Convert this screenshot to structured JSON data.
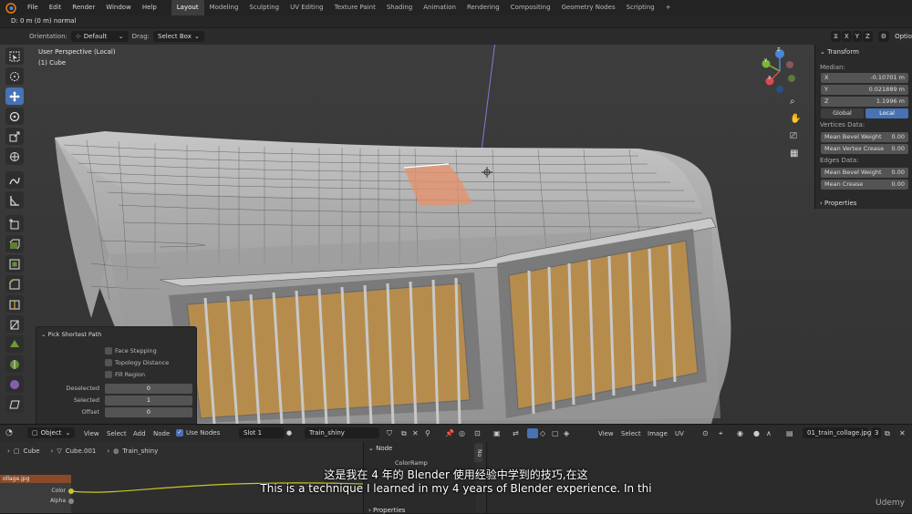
{
  "menu": [
    "File",
    "Edit",
    "Render",
    "Window",
    "Help"
  ],
  "workspaces": [
    "Layout",
    "Modeling",
    "Sculpting",
    "UV Editing",
    "Texture Paint",
    "Shading",
    "Animation",
    "Rendering",
    "Compositing",
    "Geometry Nodes",
    "Scripting"
  ],
  "workspace_add": "+",
  "status_text": "D: 0 m (0 m) normal",
  "header": {
    "orientation_label": "Orientation:",
    "orientation_value": "Default",
    "drag_label": "Drag:",
    "drag_value": "Select Box",
    "axes": [
      "X",
      "Y",
      "Z"
    ],
    "options": "Optio"
  },
  "viewport": {
    "perspective": "User Perspective (Local)",
    "object": "(1) Cube"
  },
  "gizmo": {
    "x": "X",
    "y": "Y",
    "z": "Z"
  },
  "npanel": {
    "transform": "Transform",
    "median": "Median:",
    "x_label": "X",
    "x_value": "-0.10701 m",
    "y_label": "Y",
    "y_value": "0.021889 m",
    "z_label": "Z",
    "z_value": "1.1996 m",
    "global": "Global",
    "local": "Local",
    "vertices_data": "Vertices Data:",
    "mean_bevel_weight": "Mean Bevel Weight",
    "mbw_value": "0.00",
    "mean_vertex_crease": "Mean Vertex Crease",
    "mvc_value": "0.00",
    "edges_data": "Edges Data:",
    "mean_bevel_weight2": "Mean Bevel Weight",
    "mbw2_value": "0.00",
    "mean_crease": "Mean Crease",
    "mc_value": "0.00",
    "properties": "Properties"
  },
  "operator": {
    "title": "Pick Shortest Path",
    "face_stepping": "Face Stepping",
    "topology_distance": "Topology Distance",
    "fill_region": "Fill Region",
    "deselected_label": "Deselected",
    "deselected_value": "0",
    "selected_label": "Selected",
    "selected_value": "1",
    "offset_label": "Offset",
    "offset_value": "0"
  },
  "node_header": {
    "object": "Object",
    "menus": [
      "View",
      "Select",
      "Add",
      "Node"
    ],
    "use_nodes": "Use Nodes",
    "slot": "Slot 1",
    "material": "Train_shiny"
  },
  "image_header": {
    "menus": [
      "View",
      "Select",
      "Image",
      "UV"
    ],
    "image_name": "01_train_collage.jpg",
    "users": "3"
  },
  "breadcrumb": [
    "Cube",
    "Cube.001",
    "Train_shiny"
  ],
  "node_panel": {
    "title": "Node",
    "colorramp": "ColorRamp",
    "properties": "Properties",
    "tab": "No"
  },
  "image_node": {
    "title": "ollage.jpg",
    "color": "Color",
    "alpha": "Alpha"
  },
  "subtitles": {
    "chinese": "这是我在 4 年的 Blender 使用经验中学到的技巧,在这",
    "english": "This is a technique I learned in my 4 years of Blender experience. In thi"
  },
  "watermark": "Udemy",
  "colors": {
    "accent": "#4772b3",
    "selection": "#e8906a",
    "gizmo_x": "#d94a55",
    "gizmo_y": "#7fb53a",
    "gizmo_z": "#4a86d9"
  }
}
